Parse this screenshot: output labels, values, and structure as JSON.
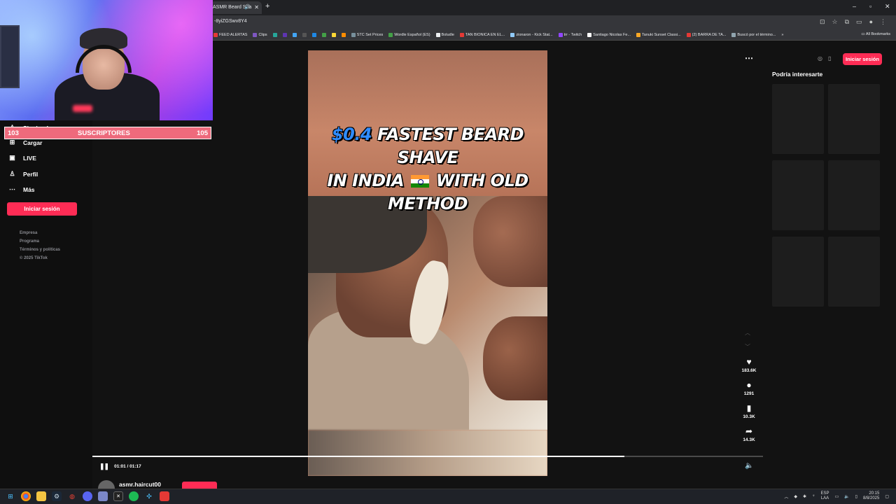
{
  "browser": {
    "tab_title": "ASMR Beard Sha",
    "new_tab": "+",
    "url": "-8yiZGSwv8Y4",
    "bookmarks": [
      "FEED ALERTAS",
      "Clips",
      "STC Set Prices",
      "Wordle Español (ES)",
      "Boludle",
      "TAN BIONICA EN EL...",
      "zionaron - Kick Stat...",
      "trr - Twitch",
      "Santiago Nicolas Fe...",
      "Tanuki Sunset Classi...",
      "(2) BARRA DE TA...",
      "Buscó por el término..."
    ],
    "all_bookmarks": "All Bookmarks"
  },
  "sidebar": {
    "items": [
      {
        "label": "Siguiendo",
        "icon": "following-icon"
      },
      {
        "label": "Cargar",
        "icon": "upload-icon"
      },
      {
        "label": "LIVE",
        "icon": "live-icon"
      },
      {
        "label": "Perfil",
        "icon": "profile-icon"
      },
      {
        "label": "Más",
        "icon": "more-icon"
      }
    ],
    "login_label": "Iniciar sesión",
    "footer": [
      "Empresa",
      "Programa",
      "Términos y políticas",
      "© 2025 TikTok"
    ]
  },
  "video": {
    "title_price": "$0.4",
    "title_line1": "FASTEST BEARD SHAVE",
    "title_line2a": "IN INDIA",
    "title_line2b": "WITH OLD",
    "title_line3": "METHOD",
    "time": "01:01 / 01:17",
    "progress": 0.793,
    "author": "asmr.haircut00"
  },
  "actions": {
    "likes": "183.6K",
    "comments": "1291",
    "saves": "10.3K",
    "shares": "14.3K"
  },
  "right_panel": {
    "login_label": "Iniciar sesión",
    "title": "Podría interesarte"
  },
  "overlay": {
    "sub_left": "103",
    "sub_label": "SUSCRIPTORES",
    "sub_right": "105"
  },
  "taskbar": {
    "lang_top": "ESP",
    "lang_bottom": "LAA",
    "time": "20:15",
    "date": "8/8/2025"
  },
  "colors": {
    "accent": "#fe2c55",
    "sub_bar": "#ee6a7c"
  }
}
